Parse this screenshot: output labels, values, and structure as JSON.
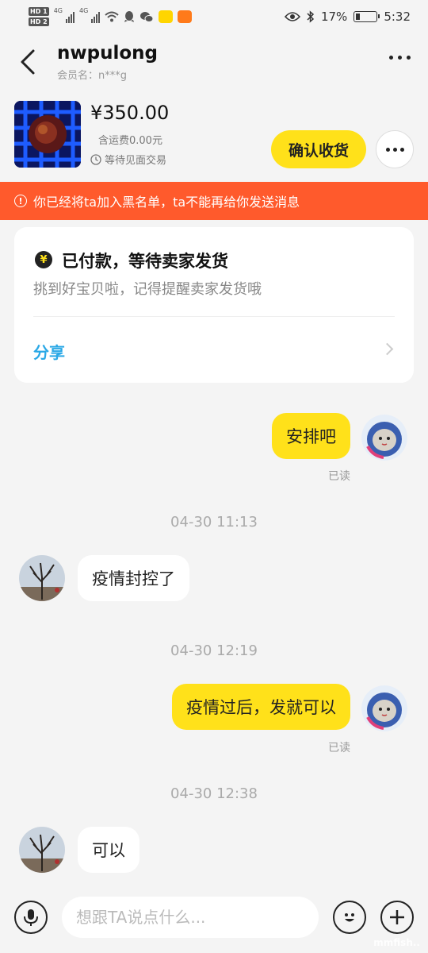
{
  "status_bar": {
    "hd1": "HD 1",
    "hd2": "HD 2",
    "net1": "4G",
    "net2": "4G",
    "battery": "17%",
    "time": "5:32"
  },
  "header": {
    "name": "nwpulong",
    "member_label": "会员名：n***g"
  },
  "order": {
    "price": "¥350.00",
    "shipping": "含运费0.00元",
    "status": "等待见面交易",
    "confirm_label": "确认收货"
  },
  "warning": {
    "text": "你已经将ta加入黑名单，ta不能再给你发送消息"
  },
  "status_card": {
    "title": "已付款，等待卖家发货",
    "subtitle": "挑到好宝贝啦，记得提醒卖家发货哦",
    "share_label": "分享",
    "icon": "yen-icon"
  },
  "messages": [
    {
      "sender": "me",
      "text": "安排吧",
      "read": "已读"
    },
    {
      "type": "time",
      "text": "04-30 11:13"
    },
    {
      "sender": "them",
      "text": "疫情封控了"
    },
    {
      "type": "time",
      "text": "04-30 12:19"
    },
    {
      "sender": "me",
      "text": "疫情过后，发就可以",
      "read": "已读"
    },
    {
      "type": "time",
      "text": "04-30 12:38"
    },
    {
      "sender": "them",
      "text": "可以"
    }
  ],
  "input": {
    "placeholder": "想跟TA说点什么..."
  },
  "colors": {
    "accent_yellow": "#ffe11a",
    "warning_orange": "#ff5a2c",
    "link_blue": "#2aa8e6"
  },
  "watermark": "mmfish.."
}
